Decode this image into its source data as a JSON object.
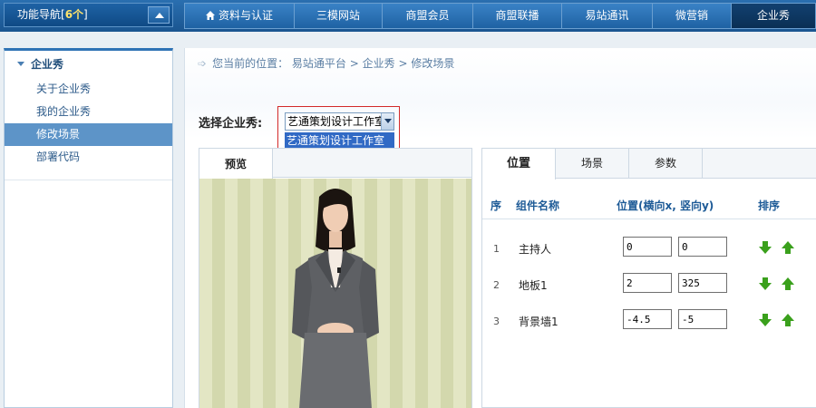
{
  "topbar": {
    "func_nav_label": "功能导航[",
    "func_nav_count": "6个",
    "func_nav_close": "]",
    "tabs": [
      {
        "label": "资料与认证",
        "width": 0
      },
      {
        "label": "三模网站"
      },
      {
        "label": "商盟会员"
      },
      {
        "label": "商盟联播"
      },
      {
        "label": "易站通讯"
      },
      {
        "label": "微营销"
      },
      {
        "label": "企业秀"
      }
    ]
  },
  "sidebar": {
    "heading": "企业秀",
    "items": [
      "关于企业秀",
      "我的企业秀",
      "修改场景",
      "部署代码"
    ]
  },
  "breadcrumb": {
    "prefix": "您当前的位置：",
    "path1": "易站通平台",
    "sep": ">",
    "path2": "企业秀",
    "path3": "修改场景"
  },
  "selector": {
    "label": "选择企业秀:",
    "selected": "艺通策划设计工作室",
    "option": "艺通策划设计工作室"
  },
  "preview": {
    "tab_label": "预览"
  },
  "panel": {
    "tabs": [
      "位置",
      "场景",
      "参数"
    ],
    "headers": {
      "seq": "序",
      "name": "组件名称",
      "pos": "位置(横向x, 竖向y)",
      "sort": "排序"
    },
    "rows": [
      {
        "idx": "1",
        "name": "主持人",
        "x": "0",
        "y": "0"
      },
      {
        "idx": "2",
        "name": "地板1",
        "x": "2",
        "y": "325"
      },
      {
        "idx": "3",
        "name": "背景墙1",
        "x": "-4.5",
        "y": "-5"
      }
    ]
  },
  "colors": {
    "accent": "#2f73b5",
    "active_tab": "#0a2f55",
    "highlight": "#d32a2a",
    "arrow_green": "#3aa01c"
  }
}
